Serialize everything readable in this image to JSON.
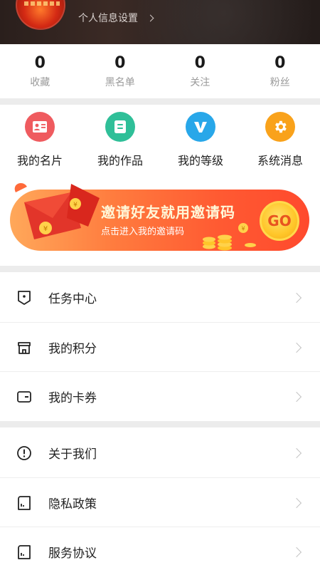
{
  "profile": {
    "settings_link": "个人信息设置"
  },
  "stats": [
    {
      "value": "0",
      "label": "收藏"
    },
    {
      "value": "0",
      "label": "黑名单"
    },
    {
      "value": "0",
      "label": "关注"
    },
    {
      "value": "0",
      "label": "粉丝"
    }
  ],
  "actions": [
    {
      "label": "我的名片",
      "icon": "business-card-icon",
      "color": "#ef5b5f"
    },
    {
      "label": "我的作品",
      "icon": "works-icon",
      "color": "#2fbf98"
    },
    {
      "label": "我的等级",
      "icon": "level-v-icon",
      "color": "#28a7e9"
    },
    {
      "label": "系统消息",
      "icon": "gear-icon",
      "color": "#f9a21b"
    }
  ],
  "banner": {
    "title": "邀请好友就用邀请码",
    "subtitle": "点击进入我的邀请码",
    "button": "GO"
  },
  "menu_group1": [
    {
      "label": "任务中心",
      "icon": "task-icon"
    },
    {
      "label": "我的积分",
      "icon": "points-store-icon"
    },
    {
      "label": "我的卡券",
      "icon": "wallet-card-icon"
    }
  ],
  "menu_group2": [
    {
      "label": "关于我们",
      "icon": "info-icon"
    },
    {
      "label": "隐私政策",
      "icon": "privacy-doc-icon"
    },
    {
      "label": "服务协议",
      "icon": "agreement-doc-icon"
    }
  ]
}
